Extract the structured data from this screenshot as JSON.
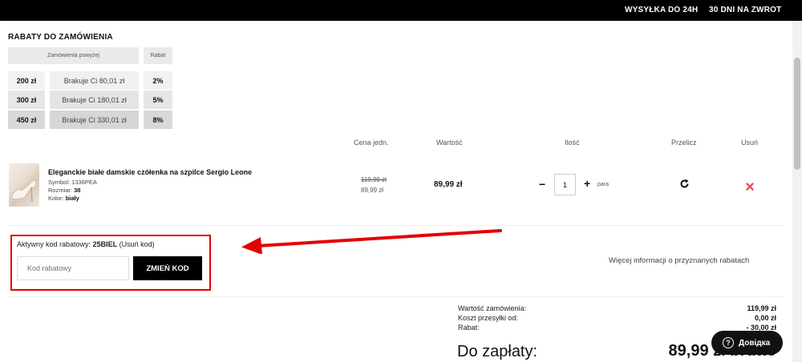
{
  "topbar": {
    "shipping": "WYSYŁKA DO 24H",
    "returns": "30 DNI NA ZWROT"
  },
  "discounts": {
    "title": "RABATY DO ZAMÓWIENIA",
    "header_above": "Zamówienia powyżej",
    "header_discount": "Rabat",
    "rows": [
      {
        "threshold": "200 zł",
        "missing": "Brakuje Ci 80,01 zł",
        "discount": "2%"
      },
      {
        "threshold": "300 zł",
        "missing": "Brakuje Ci 180,01 zł",
        "discount": "5%"
      },
      {
        "threshold": "450 zł",
        "missing": "Brakuje Ci 330,01 zł",
        "discount": "8%"
      }
    ]
  },
  "cart": {
    "columns": {
      "unit_price": "Cena jedn.",
      "value": "Wartość",
      "qty": "Ilość",
      "recalc": "Przelicz",
      "remove": "Usuń"
    },
    "item": {
      "name": "Eleganckie białe damskie czółenka na szpilce Sergio Leone",
      "symbol_label": "Symbol:",
      "symbol": "1336PEA",
      "size_label": "Rozmiar:",
      "size": "38",
      "color_label": "Kolor:",
      "color": "biały",
      "old_price": "119,99 zł",
      "price": "89,99 zł",
      "value": "89,99 zł",
      "qty": "1",
      "unit": "para",
      "minus": "−",
      "plus": "+"
    }
  },
  "coupon": {
    "active_label": "Aktywny kod rabatowy:",
    "code": "25BIEL",
    "remove_link": "(Usuń kod)",
    "placeholder": "Kod rabatowy",
    "button": "ZMIEŃ KOD",
    "more_info": "Więcej informacji o przyznanych rabatach"
  },
  "summary": {
    "order_value_label": "Wartość zamówienia:",
    "order_value": "119,99 zł",
    "shipping_label": "Koszt przesyłki od:",
    "shipping": "0,00 zł",
    "discount_label": "Rabat:",
    "discount": "- 30,00 zł",
    "total_label": "Do zapłaty:",
    "total": "89,99 zł brutto"
  },
  "help": {
    "label": "Довідка"
  },
  "colors": {
    "accent_red": "#e30000",
    "remove_red": "#e0555a",
    "black": "#000000"
  }
}
